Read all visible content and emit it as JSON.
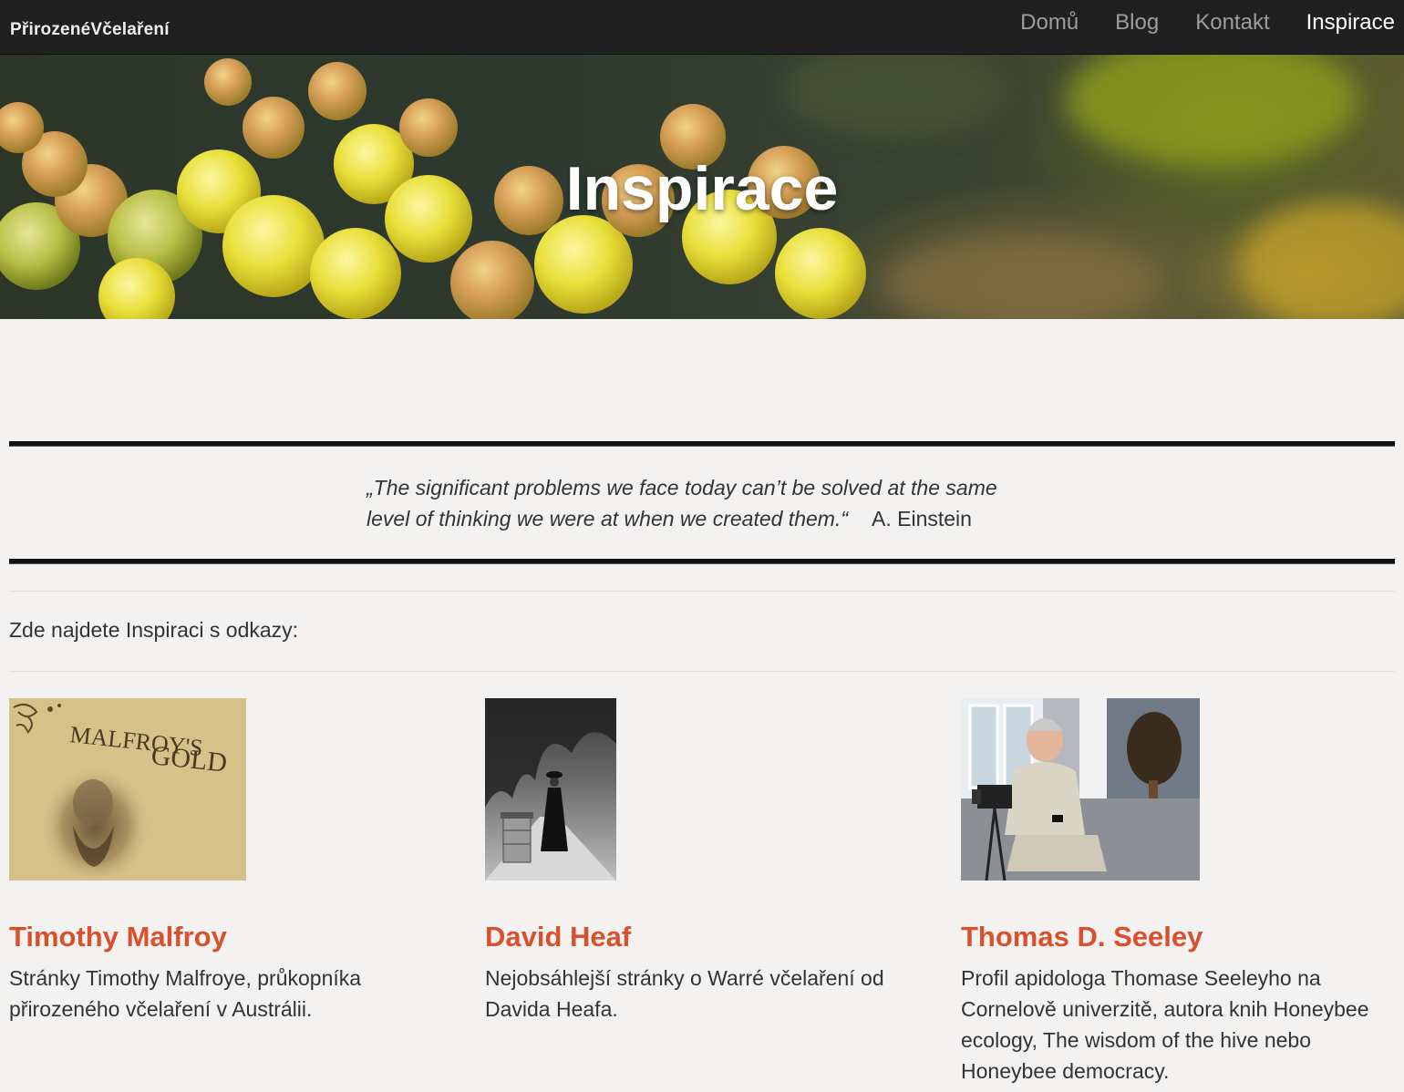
{
  "navbar": {
    "brand": "PřirozenéVčelaření",
    "items": [
      {
        "label": "Domů"
      },
      {
        "label": "Blog"
      },
      {
        "label": "Kontakt"
      },
      {
        "label": "Inspirace"
      }
    ]
  },
  "hero": {
    "title": "Inspirace"
  },
  "quote": {
    "text_line1": "„The significant problems we face today can’t be solved at the same",
    "text_line2": "level of thinking we were at when we created them.“",
    "author": "A. Einstein"
  },
  "intro": "Zde najdete Inspiraci s odkazy:",
  "cards": [
    {
      "name": "Timothy Malfroy",
      "description": "Stránky Timothy Malfroye, průkopníka přirozeného včelaření v Austrálii.",
      "image_text_line1": "MALFROY'S",
      "image_text_line2": "GOLD"
    },
    {
      "name": "David Heaf",
      "description": "Nejobsáhlejší stránky o Warré včelaření od Davida Heafa."
    },
    {
      "name": "Thomas D. Seeley",
      "description": "Profil apidologa Thomase Seeleyho na Cornelově univerzitě, autora knih Honeybee ecology, The wisdom of the hive nebo Honeybee democracy."
    }
  ],
  "colors": {
    "navbar_bg": "#202020",
    "accent": "#d9512c",
    "page_bg": "#f3f2f0"
  }
}
